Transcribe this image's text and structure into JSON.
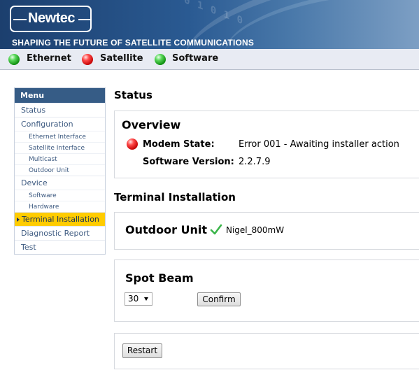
{
  "header": {
    "logo_text": "Newtec",
    "tagline": "SHAPING THE FUTURE OF SATELLITE COMMUNICATIONS",
    "banner_digits": "1 0 1 0 1 1 0 1 0 1 0"
  },
  "status_bar": {
    "indicators": [
      {
        "label": "Ethernet",
        "state": "green"
      },
      {
        "label": "Satellite",
        "state": "red"
      },
      {
        "label": "Software",
        "state": "green"
      }
    ]
  },
  "menu": {
    "title": "Menu",
    "items": [
      {
        "label": "Status",
        "level": 1
      },
      {
        "label": "Configuration",
        "level": 1
      },
      {
        "label": "Ethernet Interface",
        "level": 2
      },
      {
        "label": "Satellite Interface",
        "level": 2
      },
      {
        "label": "Multicast",
        "level": 2
      },
      {
        "label": "Outdoor Unit",
        "level": 2
      },
      {
        "label": "Device",
        "level": 1
      },
      {
        "label": "Software",
        "level": 2
      },
      {
        "label": "Hardware",
        "level": 2
      },
      {
        "label": "Terminal Installation",
        "level": 1,
        "active": true
      },
      {
        "label": "Diagnostic Report",
        "level": 1
      },
      {
        "label": "Test",
        "level": 1
      }
    ]
  },
  "main": {
    "status_heading": "Status",
    "overview": {
      "title": "Overview",
      "modem_state_label": "Modem State:",
      "modem_state_value": "Error 001 - Awaiting installer action",
      "software_version_label": "Software Version:",
      "software_version_value": "2.2.7.9"
    },
    "terminal_heading": "Terminal Installation",
    "outdoor_unit": {
      "label": "Outdoor Unit",
      "value": "Nigel_800mW"
    },
    "spot_beam": {
      "label": "Spot Beam",
      "selected": "30",
      "confirm_label": "Confirm"
    },
    "restart_label": "Restart"
  },
  "colors": {
    "menu_header": "#365c86",
    "menu_active": "#ffcc00",
    "menu_link": "#3d5a80",
    "status_bar_bg": "#e8ebf3"
  }
}
